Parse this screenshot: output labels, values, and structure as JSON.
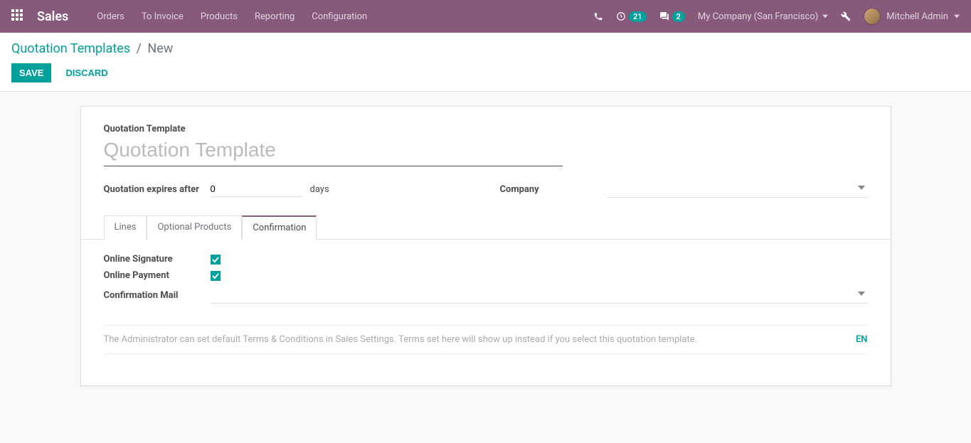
{
  "nav": {
    "title": "Sales",
    "menu": [
      "Orders",
      "To Invoice",
      "Products",
      "Reporting",
      "Configuration"
    ],
    "activity_count": "21",
    "message_count": "2",
    "company": "My Company (San Francisco)",
    "user": "Mitchell Admin"
  },
  "breadcrumb": {
    "parent": "Quotation Templates",
    "current": "New"
  },
  "buttons": {
    "save": "Save",
    "discard": "Discard"
  },
  "form": {
    "title_label": "Quotation Template",
    "title_placeholder": "Quotation Template",
    "expires_label": "Quotation expires after",
    "expires_value": "0",
    "expires_unit": "days",
    "company_label": "Company"
  },
  "tabs": {
    "lines": "Lines",
    "optional": "Optional Products",
    "confirmation": "Confirmation"
  },
  "confirmation": {
    "signature_label": "Online Signature",
    "payment_label": "Online Payment",
    "mail_label": "Confirmation Mail",
    "terms_placeholder": "The Administrator can set default Terms & Conditions in Sales Settings. Terms set here will show up instead if you select this quotation template.",
    "lang": "EN"
  }
}
